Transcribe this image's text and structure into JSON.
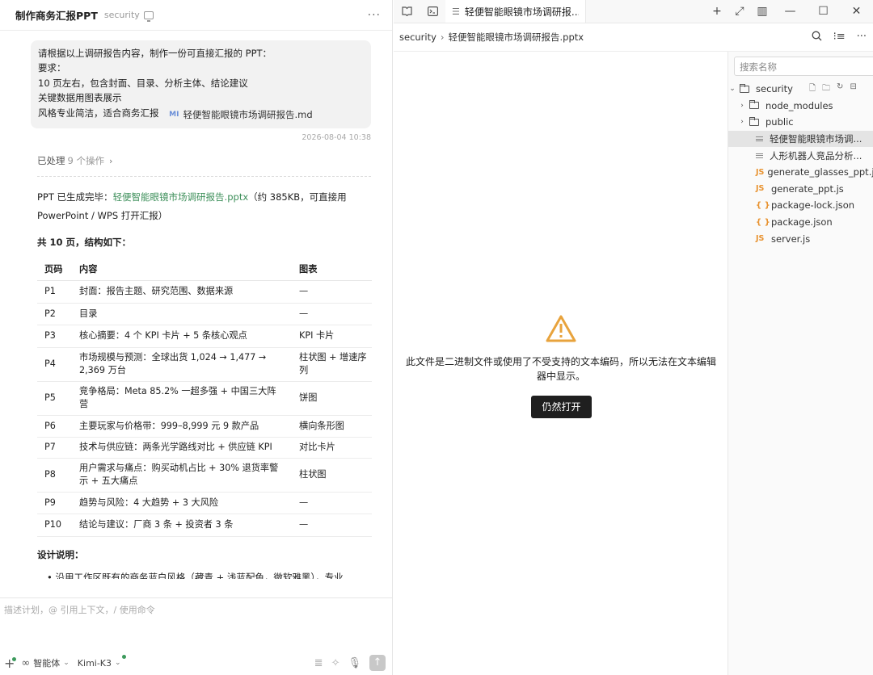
{
  "chat": {
    "title": "制作商务汇报PPT",
    "workspace": "security",
    "user_message": {
      "lines": [
        "请根据以上调研报告内容，制作一份可直接汇报的 PPT：",
        "要求：",
        "10 页左右，包含封面、目录、分析主体、结论建议",
        "关键数据用图表展示",
        "风格专业简洁，适合商务汇报"
      ],
      "attachment_icon": "MI",
      "attachment_name": "轻便智能眼镜市场调研报告.md",
      "timestamp": "2026-08-04 10:38"
    },
    "processed": {
      "label": "已处理",
      "count": "9 个操作"
    },
    "answer": {
      "prefix": "PPT 已生成完毕：",
      "file_link": "轻便智能眼镜市场调研报告.pptx",
      "suffix_1": "（约 385KB，可直接用",
      "suffix_2": "PowerPoint / WPS 打开汇报）",
      "pages_heading": "共 10 页，结构如下：",
      "table": {
        "headers": [
          "页码",
          "内容",
          "图表"
        ],
        "rows": [
          [
            "P1",
            "封面：报告主题、研究范围、数据来源",
            "—"
          ],
          [
            "P2",
            "目录",
            "—"
          ],
          [
            "P3",
            "核心摘要：4 个 KPI 卡片 + 5 条核心观点",
            "KPI 卡片"
          ],
          [
            "P4",
            "市场规模与预测：全球出货 1,024 → 1,477 → 2,369 万台",
            "柱状图 + 增速序列"
          ],
          [
            "P5",
            "竞争格局：Meta 85.2% 一超多强 + 中国三大阵营",
            "饼图"
          ],
          [
            "P6",
            "主要玩家与价格带：999–8,999 元 9 款产品",
            "横向条形图"
          ],
          [
            "P7",
            "技术与供应链：两条光学路线对比 + 供应链 KPI",
            "对比卡片"
          ],
          [
            "P8",
            "用户需求与痛点：购买动机占比 + 30% 退货率警示 + 五大痛点",
            "柱状图"
          ],
          [
            "P9",
            "趋势与风险：4 大趋势 + 3 大风险",
            "—"
          ],
          [
            "P10",
            "结论与建议：厂商 3 条 + 投资者 3 条",
            "—"
          ]
        ]
      },
      "design_heading": "设计说明：",
      "design_first_line": "• 沿用工作区既有的商务蓝白风格（藏青 + 浅蓝配色，微软雅黑），专业"
    },
    "composer": {
      "placeholder": "描述计划，@ 引用上下文，/ 使用命令",
      "agent_label": "智能体",
      "model_label": "Kimi-K3"
    }
  },
  "editor": {
    "tab_title": "轻便智能眼镜市场调研报...",
    "breadcrumb": [
      "security",
      "轻便智能眼镜市场调研报告.pptx"
    ],
    "binary_warning": "此文件是二进制文件或使用了不受支持的文本编码，所以无法在文本编辑器中显示。",
    "open_anyway": "仍然打开"
  },
  "explorer": {
    "search_placeholder": "搜索名称",
    "root": "security",
    "items": [
      {
        "name": "node_modules",
        "kind": "folder"
      },
      {
        "name": "public",
        "kind": "folder"
      },
      {
        "name": "轻便智能眼镜市场调...",
        "kind": "doc",
        "selected": true
      },
      {
        "name": "人形机器人竞品分析...",
        "kind": "doc"
      },
      {
        "name": "generate_glasses_ppt.js",
        "kind": "js"
      },
      {
        "name": "generate_ppt.js",
        "kind": "js"
      },
      {
        "name": "package-lock.json",
        "kind": "json"
      },
      {
        "name": "package.json",
        "kind": "json"
      },
      {
        "name": "server.js",
        "kind": "js"
      }
    ]
  },
  "colors": {
    "link_green": "#3d8f5a",
    "warning_orange": "#e8a33d",
    "js_orange": "#e8922f",
    "button_dark": "#1f1f1f",
    "status_dot_green": "#3c9a5c"
  }
}
